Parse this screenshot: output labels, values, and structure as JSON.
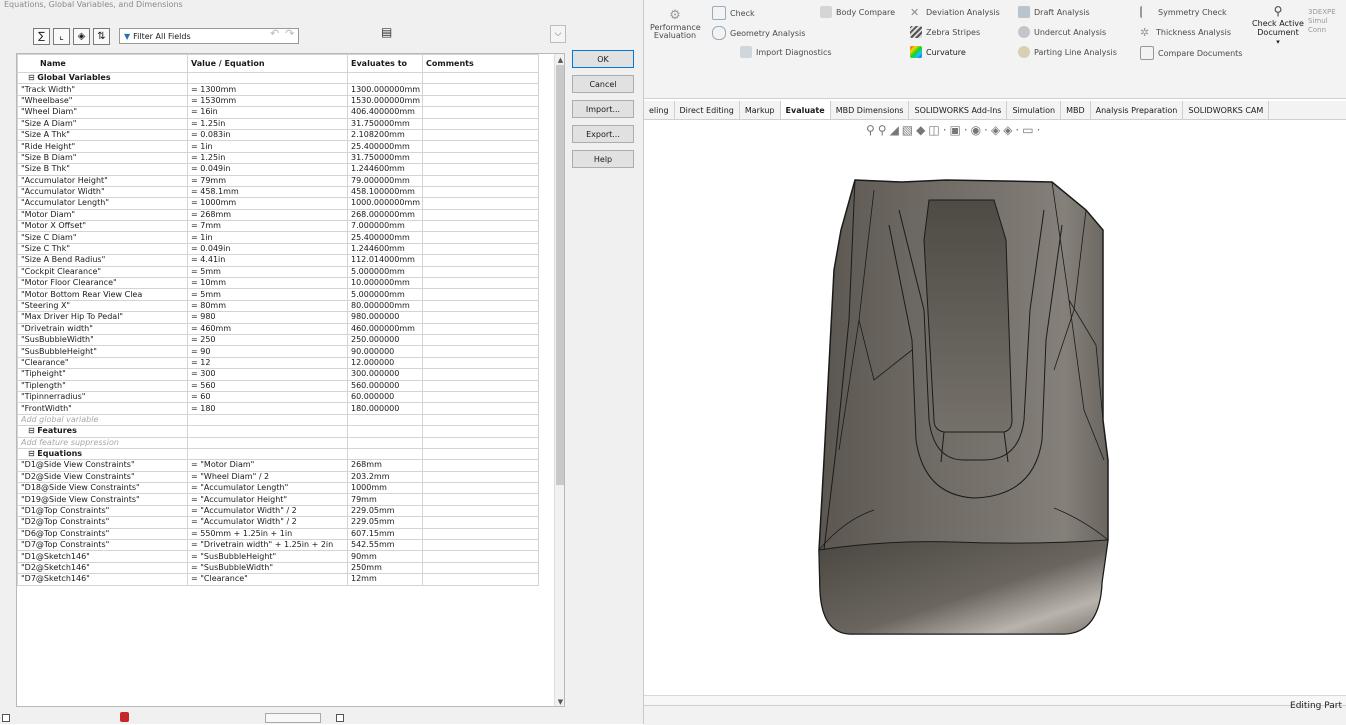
{
  "dialog": {
    "title": "Equations, Global Variables, and Dimensions",
    "filter_placeholder": "Filter All Fields",
    "columns": [
      "Name",
      "Value / Equation",
      "Evaluates to",
      "Comments"
    ],
    "sections": [
      {
        "title": "Global Variables",
        "rows": [
          [
            "\"Track Width\"",
            "= 1300mm",
            "1300.000000mm"
          ],
          [
            "\"Wheelbase\"",
            "= 1530mm",
            "1530.000000mm"
          ],
          [
            "\"Wheel Diam\"",
            "= 16in",
            "406.400000mm"
          ],
          [
            "\"Size A Diam\"",
            "= 1.25in",
            "31.750000mm"
          ],
          [
            "\"Size A Thk\"",
            "= 0.083in",
            "2.108200mm"
          ],
          [
            "\"Ride Height\"",
            "= 1in",
            "25.400000mm"
          ],
          [
            "\"Size B Diam\"",
            "= 1.25in",
            "31.750000mm"
          ],
          [
            "\"Size B Thk\"",
            "= 0.049in",
            "1.244600mm"
          ],
          [
            "\"Accumulator Height\"",
            "= 79mm",
            "79.000000mm"
          ],
          [
            "\"Accumulator Width\"",
            "= 458.1mm",
            "458.100000mm"
          ],
          [
            "\"Accumulator Length\"",
            "= 1000mm",
            "1000.000000mm"
          ],
          [
            "\"Motor Diam\"",
            "= 268mm",
            "268.000000mm"
          ],
          [
            "\"Motor X Offset\"",
            "= 7mm",
            "7.000000mm"
          ],
          [
            "\"Size C Diam\"",
            "= 1in",
            "25.400000mm"
          ],
          [
            "\"Size C Thk\"",
            "= 0.049in",
            "1.244600mm"
          ],
          [
            "\"Size A Bend Radius\"",
            "= 4.41in",
            "112.014000mm"
          ],
          [
            "\"Cockpit Clearance\"",
            "= 5mm",
            "5.000000mm"
          ],
          [
            "\"Motor Floor Clearance\"",
            "= 10mm",
            "10.000000mm"
          ],
          [
            "\"Motor Bottom Rear View Clea",
            "= 5mm",
            "5.000000mm"
          ],
          [
            "\"Steering X\"",
            "= 80mm",
            "80.000000mm"
          ],
          [
            "\"Max Driver Hip To Pedal\"",
            "= 980",
            "980.000000"
          ],
          [
            "\"Drivetrain width\"",
            "= 460mm",
            "460.000000mm"
          ],
          [
            "\"SusBubbleWidth\"",
            "= 250",
            "250.000000"
          ],
          [
            "\"SusBubbleHeight\"",
            "= 90",
            "90.000000"
          ],
          [
            "\"Clearance\"",
            "= 12",
            "12.000000"
          ],
          [
            "\"Tipheight\"",
            "= 300",
            "300.000000"
          ],
          [
            "\"Tiplength\"",
            "= 560",
            "560.000000"
          ],
          [
            "\"Tipinnerradius\"",
            "= 60",
            "60.000000"
          ],
          [
            "\"FrontWidth\"",
            "= 180",
            "180.000000"
          ]
        ],
        "add_text": "Add global variable"
      },
      {
        "title": "Features",
        "rows": [],
        "add_text": "Add feature suppression"
      },
      {
        "title": "Equations",
        "rows": [
          [
            "\"D1@Side View Constraints\"",
            "= \"Motor Diam\"",
            "268mm"
          ],
          [
            "\"D2@Side View Constraints\"",
            "= \"Wheel Diam\" / 2",
            "203.2mm"
          ],
          [
            "\"D18@Side View Constraints\"",
            "= \"Accumulator Length\"",
            "1000mm"
          ],
          [
            "\"D19@Side View Constraints\"",
            "= \"Accumulator Height\"",
            "79mm"
          ],
          [
            "\"D1@Top Constraints\"",
            "= \"Accumulator Width\" / 2",
            "229.05mm"
          ],
          [
            "\"D2@Top Constraints\"",
            "= \"Accumulator Width\" / 2",
            "229.05mm"
          ],
          [
            "\"D6@Top Constraints\"",
            "= 550mm + 1.25in + 1in",
            "607.15mm"
          ],
          [
            "\"D7@Top Constraints\"",
            "= \"Drivetrain width\" + 1.25in + 2in",
            "542.55mm"
          ],
          [
            "\"D1@Sketch146\"",
            "= \"SusBubbleHeight\"",
            "90mm"
          ],
          [
            "\"D2@Sketch146\"",
            "= \"SusBubbleWidth\"",
            "250mm"
          ],
          [
            "\"D7@Sketch146\"",
            "= \"Clearance\"",
            "12mm"
          ]
        ],
        "add_text": ""
      }
    ],
    "buttons": [
      "OK",
      "Cancel",
      "Import...",
      "Export...",
      "Help"
    ]
  },
  "ribbon": {
    "performance_evaluation": "Performance Evaluation",
    "check": "Check",
    "geometry_analysis": "Geometry Analysis",
    "import_diagnostics": "Import Diagnostics",
    "body_compare": "Body Compare",
    "deviation_analysis": "Deviation Analysis",
    "zebra_stripes": "Zebra Stripes",
    "curvature": "Curvature",
    "draft_analysis": "Draft Analysis",
    "undercut_analysis": "Undercut Analysis",
    "parting_line_analysis": "Parting Line Analysis",
    "symmetry_check": "Symmetry Check",
    "thickness_analysis": "Thickness Analysis",
    "compare_documents": "Compare Documents",
    "check_active_document": "Check Active Document",
    "overflow_label": "3DEXPE Simul Conn"
  },
  "tabs": [
    {
      "label": "eling",
      "active": false
    },
    {
      "label": "Direct Editing",
      "active": false
    },
    {
      "label": "Markup",
      "active": false
    },
    {
      "label": "Evaluate",
      "active": true
    },
    {
      "label": "MBD Dimensions",
      "active": false
    },
    {
      "label": "SOLIDWORKS Add-Ins",
      "active": false
    },
    {
      "label": "Simulation",
      "active": false
    },
    {
      "label": "MBD",
      "active": false
    },
    {
      "label": "Analysis Preparation",
      "active": false
    },
    {
      "label": "SOLIDWORKS CAM",
      "active": false
    }
  ],
  "status": {
    "mode": "Editing Part"
  }
}
